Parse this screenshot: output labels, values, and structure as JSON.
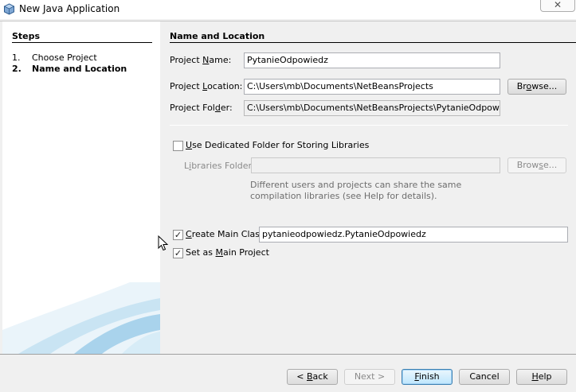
{
  "window": {
    "title": "New Java Application",
    "close_glyph": "✕"
  },
  "steps": {
    "title": "Steps",
    "items": [
      {
        "num": "1.",
        "label": "Choose Project"
      },
      {
        "num": "2.",
        "label": "Name and Location"
      }
    ]
  },
  "section": {
    "title": "Name and Location"
  },
  "project_name": {
    "label_pre": "Project ",
    "label_mn": "N",
    "label_post": "ame:",
    "value": "PytanieOdpowiedz"
  },
  "project_location": {
    "label_pre": "Project ",
    "label_mn": "L",
    "label_post": "ocation:",
    "value": "C:\\Users\\mb\\Documents\\NetBeansProjects",
    "browse_pre": "Br",
    "browse_mn": "o",
    "browse_post": "wse..."
  },
  "project_folder": {
    "label_pre": "Project Fol",
    "label_mn": "d",
    "label_post": "er:",
    "value": "C:\\Users\\mb\\Documents\\NetBeansProjects\\PytanieOdpowiedz"
  },
  "dedicated_folder": {
    "checked": false,
    "label_mn": "U",
    "label_post": "se Dedicated Folder for Storing Libraries"
  },
  "libraries_folder": {
    "label_pre": "L",
    "label_mn": "i",
    "label_post": "braries Folder:",
    "value": "",
    "browse_pre": "Brow",
    "browse_mn": "s",
    "browse_post": "e...",
    "help": "Different users and projects can share the same compilation libraries (see Help for details)."
  },
  "create_main_class": {
    "checked": true,
    "check_glyph": "✓",
    "label_pre": "",
    "label_mn": "C",
    "label_post": "reate Main Class",
    "value": "pytanieodpowiedz.PytanieOdpowiedz"
  },
  "set_main_project": {
    "checked": true,
    "check_glyph": "✓",
    "label_pre": "Set as ",
    "label_mn": "M",
    "label_post": "ain Project"
  },
  "buttons": {
    "back_pre": "< ",
    "back_mn": "B",
    "back_post": "ack",
    "next": "Next >",
    "finish_mn": "F",
    "finish_post": "inish",
    "cancel": "Cancel",
    "help_mn": "H",
    "help_post": "elp"
  }
}
